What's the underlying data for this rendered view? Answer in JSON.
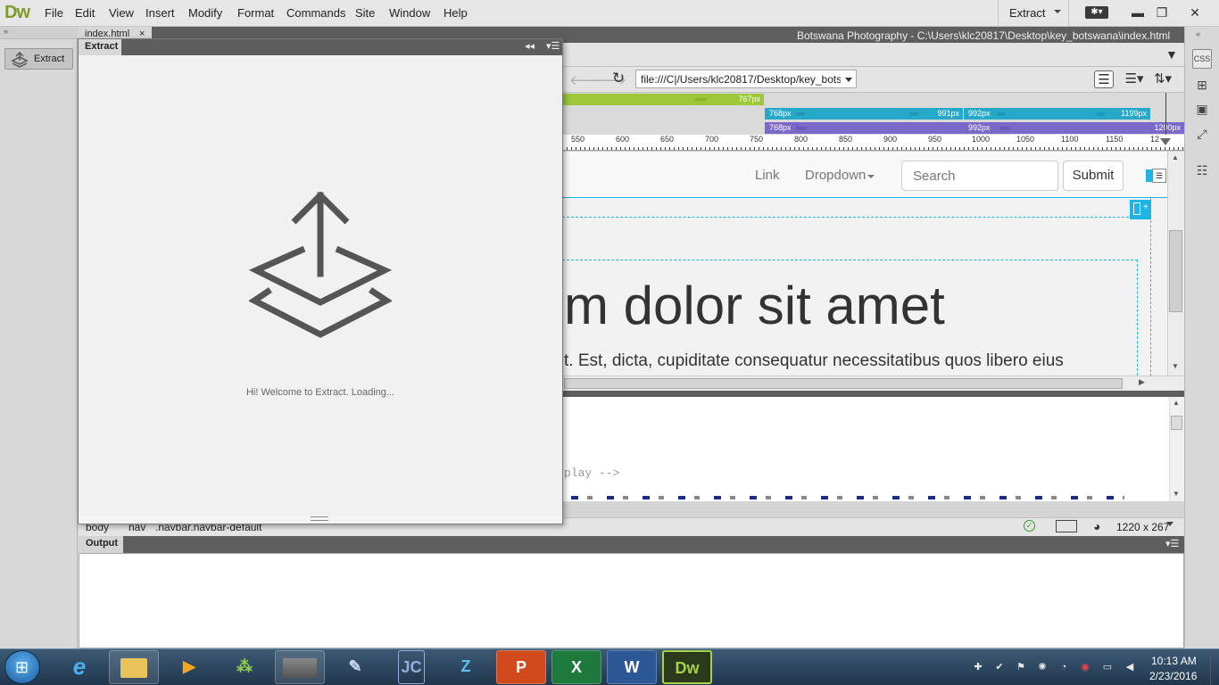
{
  "app": {
    "logo": "Dw",
    "menu": [
      "File",
      "Edit",
      "View",
      "Insert",
      "Modify",
      "Format",
      "Commands",
      "Site",
      "Window",
      "Help"
    ],
    "workspace": "Extract",
    "window_controls": {
      "minimize": "▬",
      "restore": "❐",
      "close": "✕"
    }
  },
  "left_panel": {
    "extract_button_label": "Extract"
  },
  "document": {
    "tab_label": "index.html",
    "tab_close": "×",
    "title_path": "Botswana Photography - C:\\Users\\klc20817\\Desktop\\key_botswana\\index.html",
    "url": "file:///C|/Users/klc20817/Desktop/key_botswana/index.html",
    "media_queries": {
      "green_label": "767px",
      "cyan_start": "768px",
      "cyan_mid_end": "991px",
      "cyan_mid_start": "992px",
      "cyan_end": "1199px",
      "purple_start": "768px",
      "purple_mid": "992px",
      "purple_end": "1200px"
    },
    "ruler_labels": [
      "550",
      "600",
      "650",
      "700",
      "750",
      "800",
      "850",
      "900",
      "950",
      "1000",
      "1050",
      "1100",
      "1150",
      "12"
    ],
    "design": {
      "nav_link": "Link",
      "nav_dropdown": "Dropdown",
      "search_placeholder": "Search",
      "submit_label": "Submit",
      "heading": "m dolor sit amet",
      "lead": "t. Est, dicta, cupiditate consequatur necessitatibus quos libero eius"
    },
    "code_line": "play -->",
    "status": {
      "crumbs": [
        "body",
        "nav",
        ".navbar.navbar-default"
      ],
      "dimension": "1220 x 267"
    }
  },
  "extract_panel": {
    "tab_label": "Extract",
    "message": "Hi! Welcome to Extract. Loading..."
  },
  "output_panel": {
    "tab_label": "Output"
  },
  "taskbar": {
    "time": "10:13 AM",
    "date": "2/23/2016",
    "apps": [
      "explorer",
      "ie",
      "media-player",
      "games",
      "blank",
      "scanner",
      "jc",
      "zoom",
      "powerpoint",
      "excel",
      "word",
      "dreamweaver"
    ]
  },
  "colors": {
    "dw_brand": "#7f9b2b",
    "mq_green": "#9cc83a",
    "mq_cyan": "#26a9c9",
    "mq_purple": "#7b68c8",
    "selection_blue": "#1fb3e6"
  }
}
